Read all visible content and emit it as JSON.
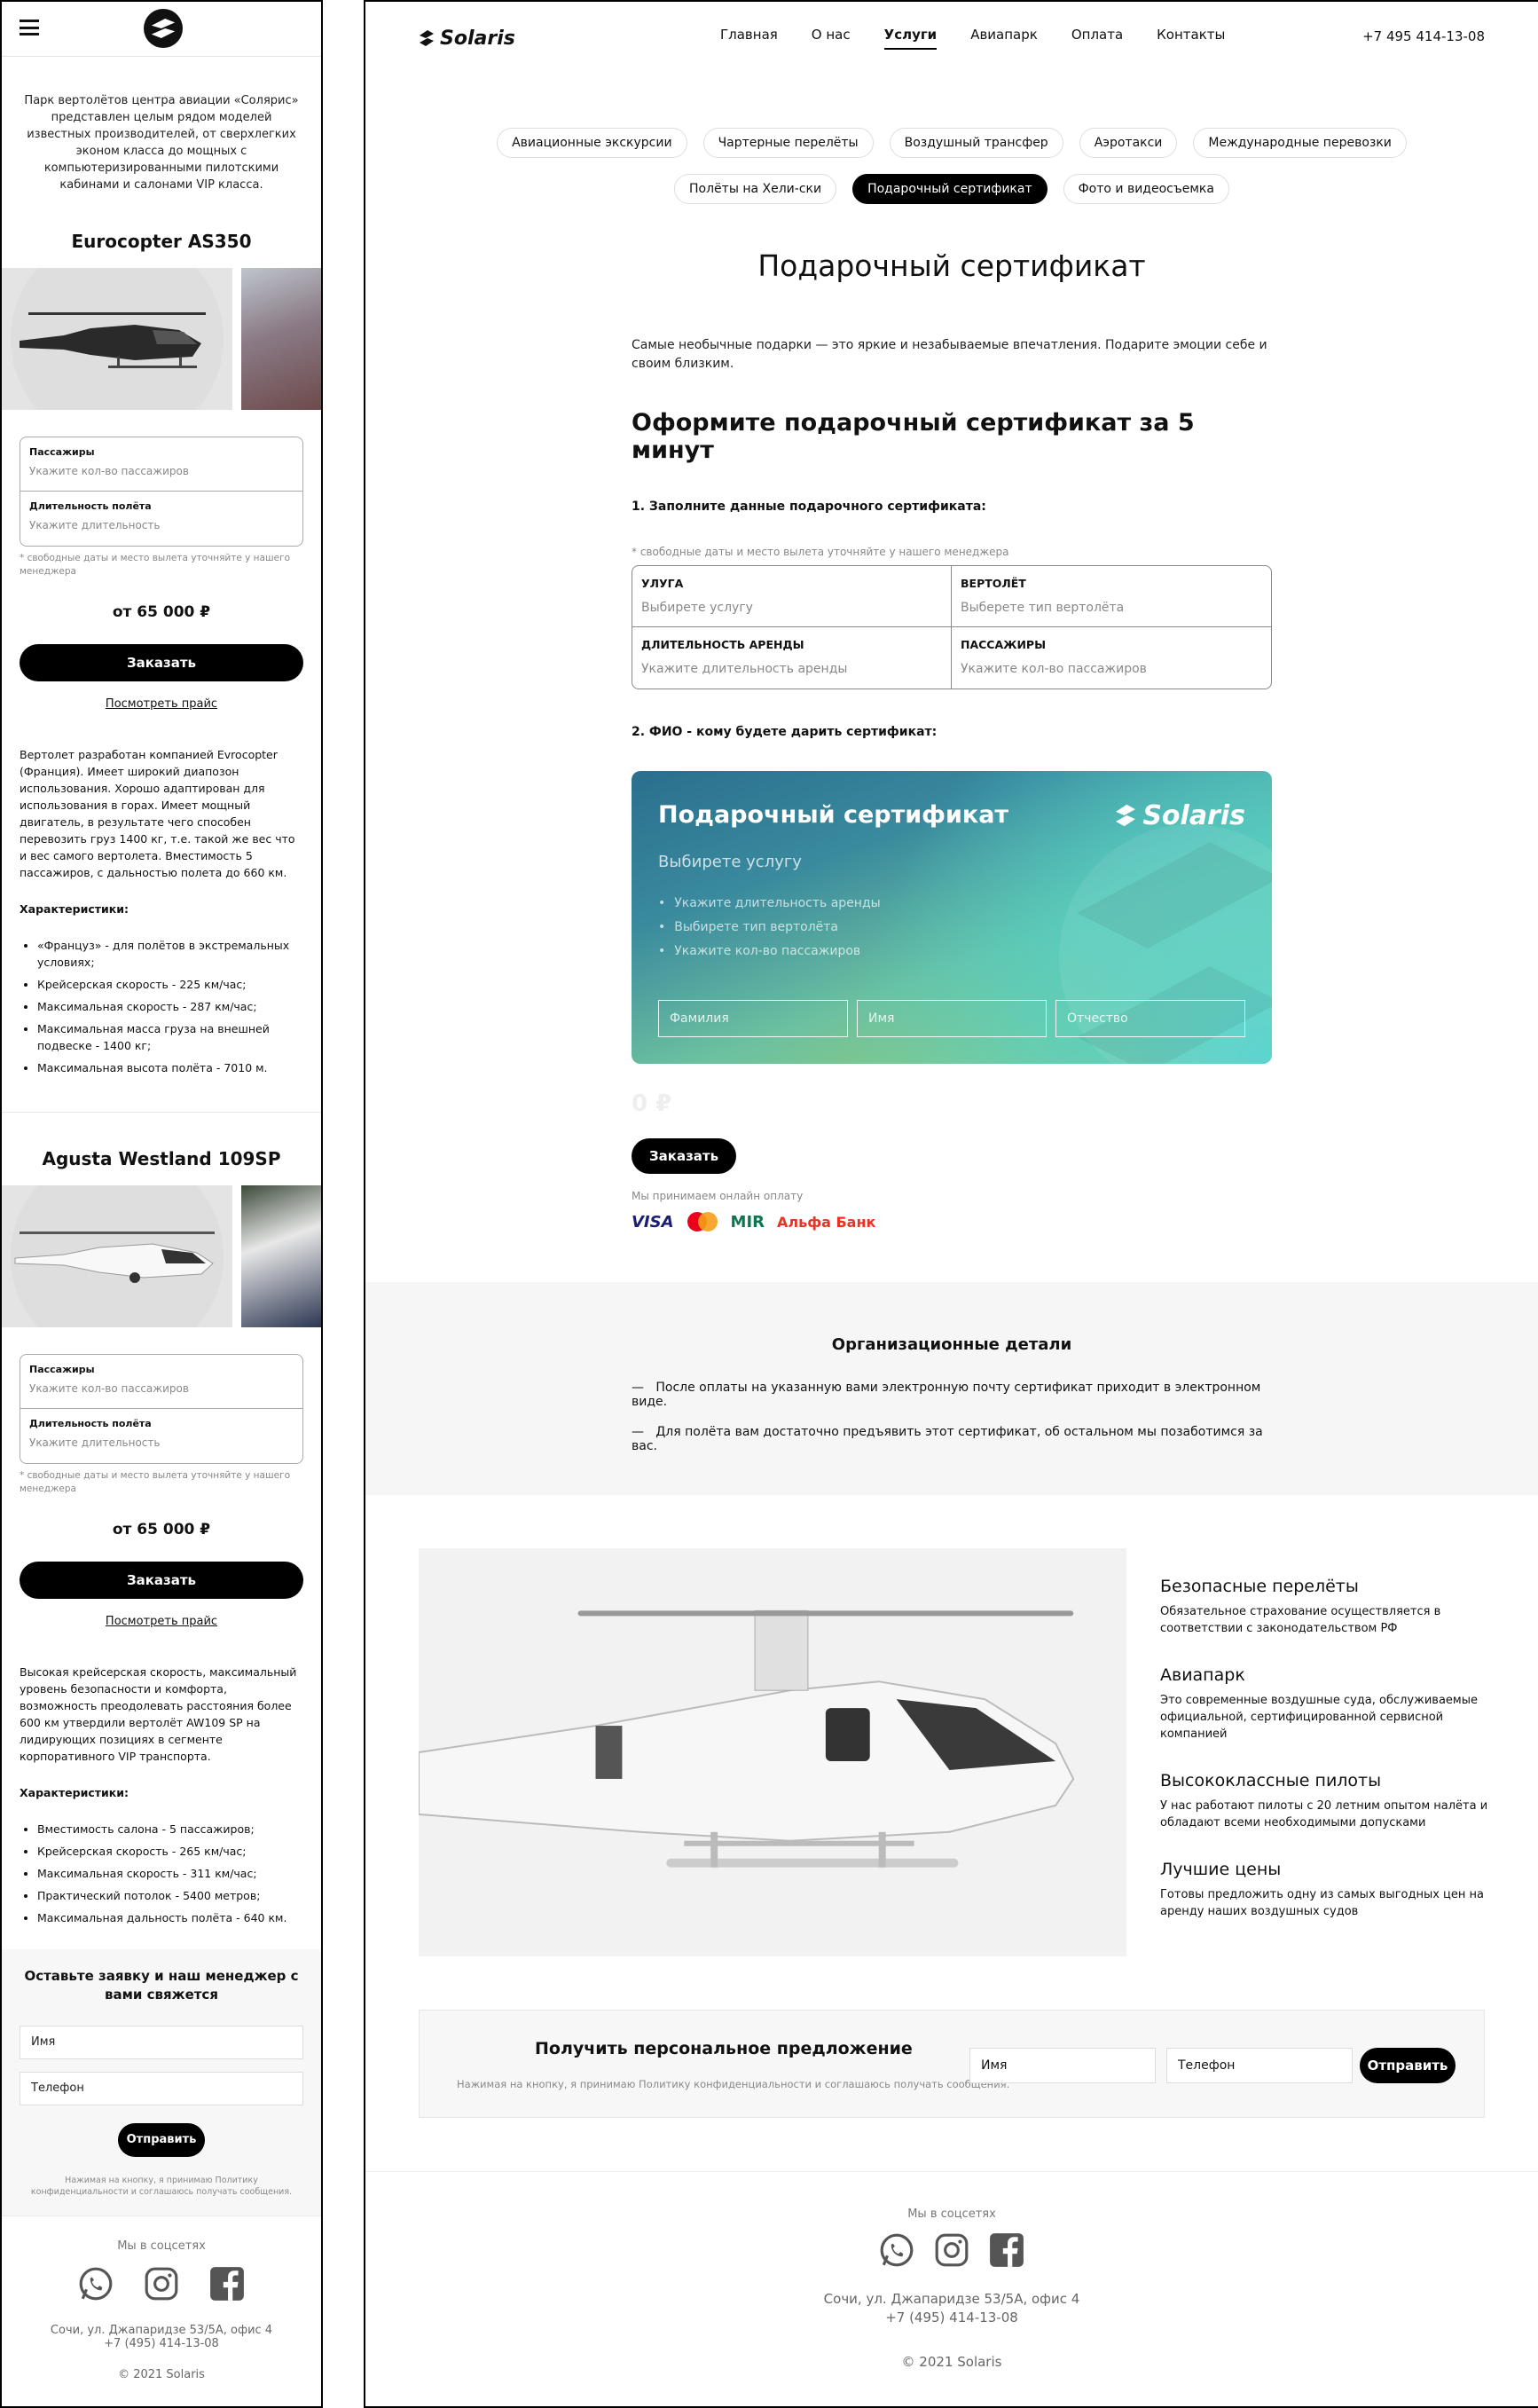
{
  "mobile": {
    "intro": "Парк вертолётов центра авиации «Солярис» представлен целым рядом моделей известных производителей, от сверхлегких эконом класса до мощных с компьютеризированными пилотскими кабинами и салонами VIP класса.",
    "models": [
      {
        "name": "Eurocopter AS350",
        "passengers_label": "Пассажиры",
        "passengers_placeholder": "Укажите кол-во пассажиров",
        "duration_label": "Длительность полёта",
        "duration_placeholder": "Укажите длительность",
        "note": "* свободные даты и место вылета уточняйте у нашего менеджера",
        "price": "от 65 000 ₽",
        "order_label": "Заказать",
        "price_link": "Посмотреть прайс",
        "description": "Вертолет разработан компанией Evrocopter (Франция). Имеет широкий диапозон использования. Хорошо адаптирован для использования в горах. Имеет мощный двигатель, в результате чего способен перевозить груз 1400 кг, т.е. такой же вес что и вес самого вертолета. Вместимость 5 пассажиров, с дальностью полета до 660 км.",
        "specs_title": "Характеристики:",
        "specs": [
          "«Француз» - для полётов в экстремальных условиях;",
          "Крейсерская скорость - 225 км/час;",
          "Максимальная скорость - 287 км/час;",
          "Максимальная масса груза на внешней подвеске - 1400 кг;",
          "Максимальная высота полёта - 7010 м."
        ]
      },
      {
        "name": "Agusta Westland 109SP",
        "passengers_label": "Пассажиры",
        "passengers_placeholder": "Укажите кол-во пассажиров",
        "duration_label": "Длительность полёта",
        "duration_placeholder": "Укажите длительность",
        "note": "* свободные даты и место вылета уточняйте у нашего менеджера",
        "price": "от 65 000 ₽",
        "order_label": "Заказать",
        "price_link": "Посмотреть прайс",
        "description": "Высокая крейсерская скорость, максимальный уровень безопасности и комфорта, возможность преодолевать расстояния более 600 км утвердили вертолёт AW109 SP на лидирующих позициях в сегменте корпоративного VIP транспорта.",
        "specs_title": "Характеристики:",
        "specs": [
          "Вместимость салона - 5 пассажиров;",
          "Крейсерская скорость - 265 км/час;",
          "Максимальная скорость - 311 км/час;",
          "Практический потолок - 5400 метров;",
          "Максимальная дальность полёта - 640 км."
        ]
      }
    ],
    "lead": {
      "title": "Оставьте заявку и наш менеджер с вами свяжется",
      "name_placeholder": "Имя",
      "phone_placeholder": "Телефон",
      "send_label": "Отправить",
      "consent": "Нажимая на кнопку, я принимаю Политику конфиденциальности и соглашаюсь получать сообщения."
    },
    "footer": {
      "social_title": "Мы в соцсетях",
      "address": "Сочи, ул. Джапаридзе 53/5А, офис 4",
      "phone": "+7 (495) 414-13-08",
      "copyright": "© 2021 Solaris"
    }
  },
  "desktop": {
    "logo": "Solaris",
    "nav": [
      "Главная",
      "О нас",
      "Услуги",
      "Авиапарк",
      "Оплата",
      "Контакты"
    ],
    "phone": "+7 495 414-13-08",
    "chips": [
      "Авиационные экскурсии",
      "Чартерные перелёты",
      "Воздушный трансфер",
      "Аэротакси",
      "Международные перевозки",
      "Полёты на Хели-ски",
      "Подарочный сертификат",
      "Фото и видеосъемка"
    ],
    "active_chip": "Подарочный сертификат",
    "page_title": "Подарочный сертификат",
    "intro": "Самые необычные подарки — это яркие и незабываемые впечатления. Подарите эмоции себе и своим близким.",
    "heading": "Оформите подарочный сертификат за 5 минут",
    "step1": "1. Заполните данные подарочного сертификата:",
    "note": "* свободные даты и место вылета уточняйте у нашего менеджера",
    "form": {
      "service_label": "УЛУГА",
      "service_placeholder": "Выбирете услугу",
      "heli_label": "ВЕРТОЛЁТ",
      "heli_placeholder": "Выберете тип вертолёта",
      "duration_label": "ДЛИТЕЛЬНОСТЬ АРЕНДЫ",
      "duration_placeholder": "Укажите длительность аренды",
      "pass_label": "ПАССАЖИРЫ",
      "pass_placeholder": "Укажите кол-во пассажиров"
    },
    "step2": "2. ФИО - кому будете дарить сертификат:",
    "certificate": {
      "title": "Подарочный сертификат",
      "logo": "Solaris",
      "service": "Выбирете услугу",
      "items": [
        "Укажите длительность аренды",
        "Выбирете тип вертолёта",
        "Укажите кол-во пассажиров"
      ],
      "surname": "Фамилия",
      "name": "Имя",
      "patronymic": "Отчество"
    },
    "total": "0 ₽",
    "order_label": "Заказать",
    "payment_note": "Мы принимаем онлайн оплату",
    "payment_logos": [
      "VISA",
      "MIR",
      "Альфа Банк"
    ],
    "org": {
      "title": "Организационные детали",
      "items": [
        "После оплаты на указанную вами электронную почту сертификат приходит в электронном виде.",
        "Для полёта вам достаточно предъявить этот сертификат, об остальном мы позаботимся за вас."
      ]
    },
    "features": [
      {
        "title": "Безопасные перелёты",
        "text": "Обязательное страхование осуществляется в соответствии с законодательством РФ"
      },
      {
        "title": "Авиапарк",
        "text": "Это современные воздушные суда, обслуживаемые официальной, сертифицированной сервисной компанией"
      },
      {
        "title": "Высококлассные пилоты",
        "text": "У нас работают пилоты с 20 летним опытом налёта и обладают всеми необходимыми допусками"
      },
      {
        "title": "Лучшие цены",
        "text": "Готовы предложить одну из самых выгодных цен на аренду наших воздушных судов"
      }
    ],
    "offer": {
      "title": "Получить персональное предложение",
      "consent": "Нажимая на кнопку, я принимаю Политику конфиденциальности и соглашаюсь получать сообщения.",
      "name_placeholder": "Имя",
      "phone_placeholder": "Телефон",
      "send_label": "Отправить"
    },
    "footer": {
      "social_title": "Мы в соцсетях",
      "address": "Сочи, ул. Джапаридзе 53/5А, офис 4",
      "phone": "+7 (495) 414-13-08",
      "copyright": "© 2021 Solaris"
    }
  }
}
